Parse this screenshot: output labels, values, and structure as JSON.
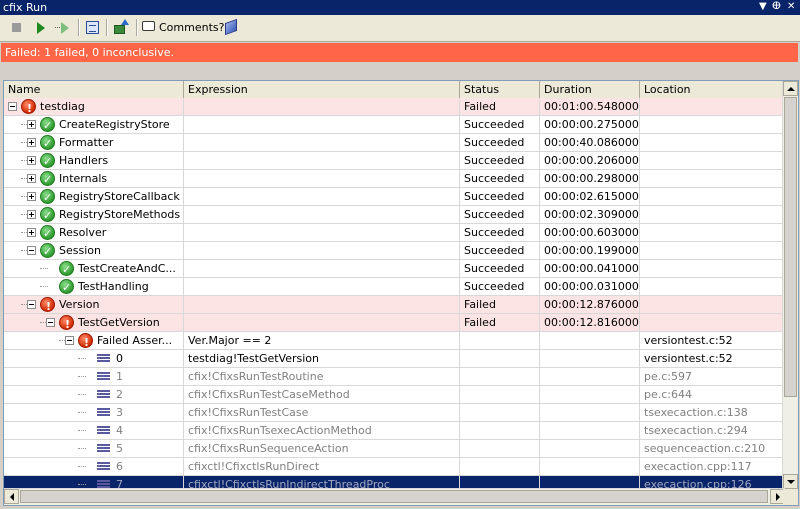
{
  "window": {
    "title": "cfix Run"
  },
  "toolbar": {
    "comments_label": "Comments?"
  },
  "banner": {
    "text": "Failed: 1 failed, 0 inconclusive.",
    "color": "#ff6648"
  },
  "columns": [
    "Name",
    "Expression",
    "Status",
    "Duration",
    "Location"
  ],
  "rows": [
    {
      "name": "testdiag",
      "expression": "",
      "status": "Failed",
      "duration": "00:01:00.5480000",
      "location": "",
      "level": 0,
      "icon": "error",
      "expander": "minus",
      "state": "fail"
    },
    {
      "name": "CreateRegistryStore",
      "expression": "",
      "status": "Succeeded",
      "duration": "00:00:00.2750000",
      "location": "",
      "level": 1,
      "icon": "ok",
      "expander": "plus",
      "state": "normal"
    },
    {
      "name": "Formatter",
      "expression": "",
      "status": "Succeeded",
      "duration": "00:00:40.0860000",
      "location": "",
      "level": 1,
      "icon": "ok",
      "expander": "plus",
      "state": "normal"
    },
    {
      "name": "Handlers",
      "expression": "",
      "status": "Succeeded",
      "duration": "00:00:00.2060000",
      "location": "",
      "level": 1,
      "icon": "ok",
      "expander": "plus",
      "state": "normal"
    },
    {
      "name": "Internals",
      "expression": "",
      "status": "Succeeded",
      "duration": "00:00:00.2980000",
      "location": "",
      "level": 1,
      "icon": "ok",
      "expander": "plus",
      "state": "normal"
    },
    {
      "name": "RegistryStoreCallback",
      "expression": "",
      "status": "Succeeded",
      "duration": "00:00:02.6150000",
      "location": "",
      "level": 1,
      "icon": "ok",
      "expander": "plus",
      "state": "normal"
    },
    {
      "name": "RegistryStoreMethods",
      "expression": "",
      "status": "Succeeded",
      "duration": "00:00:02.3090000",
      "location": "",
      "level": 1,
      "icon": "ok",
      "expander": "plus",
      "state": "normal"
    },
    {
      "name": "Resolver",
      "expression": "",
      "status": "Succeeded",
      "duration": "00:00:00.6030000",
      "location": "",
      "level": 1,
      "icon": "ok",
      "expander": "plus",
      "state": "normal"
    },
    {
      "name": "Session",
      "expression": "",
      "status": "Succeeded",
      "duration": "00:00:00.1990000",
      "location": "",
      "level": 1,
      "icon": "ok",
      "expander": "minus",
      "state": "normal"
    },
    {
      "name": "TestCreateAndC...",
      "expression": "",
      "status": "Succeeded",
      "duration": "00:00:00.0410000",
      "location": "",
      "level": 2,
      "icon": "ok",
      "expander": "none",
      "state": "normal"
    },
    {
      "name": "TestHandling",
      "expression": "",
      "status": "Succeeded",
      "duration": "00:00:00.0310000",
      "location": "",
      "level": 2,
      "icon": "ok",
      "expander": "none",
      "state": "normal"
    },
    {
      "name": "Version",
      "expression": "",
      "status": "Failed",
      "duration": "00:00:12.8760000",
      "location": "",
      "level": 1,
      "icon": "error",
      "expander": "minus",
      "state": "fail"
    },
    {
      "name": "TestGetVersion",
      "expression": "",
      "status": "Failed",
      "duration": "00:00:12.8160000",
      "location": "",
      "level": 2,
      "icon": "error",
      "expander": "minus",
      "state": "fail"
    },
    {
      "name": "Failed Asser...",
      "expression": "Ver.Major == 2",
      "status": "",
      "duration": "",
      "location": "versiontest.c:52",
      "level": 3,
      "icon": "error",
      "expander": "minus",
      "state": "normal"
    },
    {
      "name": "0",
      "expression": "testdiag!TestGetVersion",
      "status": "",
      "duration": "",
      "location": "versiontest.c:52",
      "level": 4,
      "icon": "frame",
      "expander": "none",
      "state": "normal"
    },
    {
      "name": "1",
      "expression": "cfix!CfixsRunTestRoutine",
      "status": "",
      "duration": "",
      "location": "pe.c:597",
      "level": 4,
      "icon": "frame",
      "expander": "none",
      "state": "gray"
    },
    {
      "name": "2",
      "expression": "cfix!CfixsRunTestCaseMethod",
      "status": "",
      "duration": "",
      "location": "pe.c:644",
      "level": 4,
      "icon": "frame",
      "expander": "none",
      "state": "gray"
    },
    {
      "name": "3",
      "expression": "cfix!CfixsRunTestCase",
      "status": "",
      "duration": "",
      "location": "tsexecaction.c:138",
      "level": 4,
      "icon": "frame",
      "expander": "none",
      "state": "gray"
    },
    {
      "name": "4",
      "expression": "cfix!CfixsRunTsexecActionMethod",
      "status": "",
      "duration": "",
      "location": "tsexecaction.c:294",
      "level": 4,
      "icon": "frame",
      "expander": "none",
      "state": "gray"
    },
    {
      "name": "5",
      "expression": "cfix!CfixsRunSequenceAction",
      "status": "",
      "duration": "",
      "location": "sequenceaction.c:210",
      "level": 4,
      "icon": "frame",
      "expander": "none",
      "state": "gray"
    },
    {
      "name": "6",
      "expression": "cfixctl!CfixctlsRunDirect",
      "status": "",
      "duration": "",
      "location": "execaction.cpp:117",
      "level": 4,
      "icon": "frame",
      "expander": "none",
      "state": "gray"
    },
    {
      "name": "7",
      "expression": "cfixctl!CfixctlsRunIndirectThreadProc",
      "status": "",
      "duration": "",
      "location": "execaction.cpp:126",
      "level": 4,
      "icon": "frame",
      "expander": "none",
      "state": "selected"
    }
  ]
}
